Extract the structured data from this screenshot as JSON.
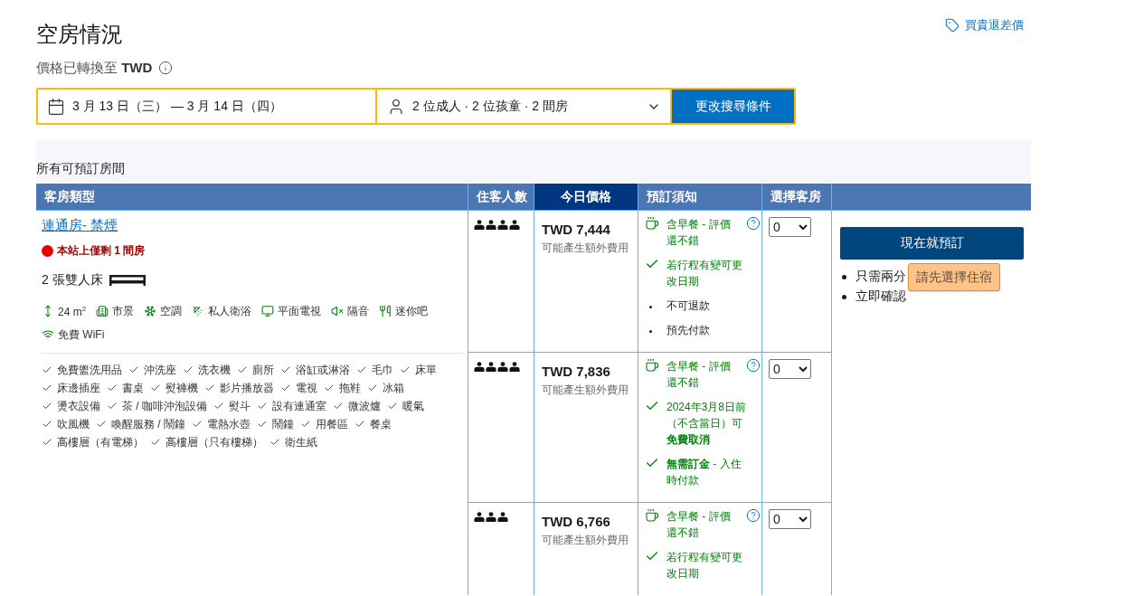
{
  "header": {
    "title": "空房情況",
    "currency_note": "價格已轉換至 **TWD**",
    "price_match_link": "買貴退差價"
  },
  "search": {
    "dates": "3 月 13 日（三） — 3 月 14 日（四）",
    "guests": "2 位成人 · 2 位孩童 · 2 間房",
    "button": "更改搜尋條件"
  },
  "rooms_section": {
    "title": "所有可預訂房間"
  },
  "table": {
    "columns": [
      {
        "label": "客房類型",
        "highlighted": false
      },
      {
        "label": "住客人數",
        "highlighted": false
      },
      {
        "label": "今日價格",
        "highlighted": true
      },
      {
        "label": "預訂須知",
        "highlighted": false
      },
      {
        "label": "選擇客房",
        "highlighted": false
      }
    ],
    "room": {
      "name": "連通房- 禁煙",
      "scarcity": "本站上僅剩 1 間房",
      "beds": "2 張雙人床",
      "facilities": [
        {
          "kind": "size",
          "label": "24 m$^{2}$"
        },
        {
          "kind": "view",
          "label": "市景"
        },
        {
          "kind": "ac",
          "label": "空調"
        },
        {
          "kind": "bathroom",
          "label": "私人衛浴"
        },
        {
          "kind": "tv",
          "label": "平面電視"
        },
        {
          "kind": "soundproof",
          "label": "隔音"
        },
        {
          "kind": "minibar",
          "label": "迷你吧"
        },
        {
          "kind": "wifi",
          "label": "免費 WiFi"
        }
      ],
      "amenities": [
        "免費盥洗用品",
        "沖洗座",
        "洗衣機",
        "廁所",
        "浴缸或淋浴",
        "毛巾",
        "床單",
        "床邊插座",
        "書桌",
        "熨褲機",
        "影片播放器",
        "電視",
        "拖鞋",
        "冰箱",
        "燙衣設備",
        "茶 / 咖啡沖泡設備",
        "熨斗",
        "設有連通室",
        "微波爐",
        "暖氣",
        "吹風機",
        "喚醒服務 / 鬧鐘",
        "電熱水壺",
        "鬧鐘",
        "用餐區",
        "餐桌",
        "高樓層（有電梯）",
        "高樓層（只有樓梯）",
        "衛生紙"
      ]
    },
    "rows": [
      {
        "occupancy": [
          {
            "kind": "person"
          },
          {
            "kind": "person"
          },
          {
            "kind": "person"
          },
          {
            "kind": "person"
          }
        ],
        "price": "TWD 7,444",
        "price_note": "可能產生額外費用",
        "conditions": [
          {
            "kind": "meal",
            "text": "含早餐 - 評價還不錯"
          },
          {
            "kind": "check",
            "text": "若行程有變可更改日期"
          },
          {
            "kind": "bullet",
            "text": "不可退款"
          },
          {
            "kind": "bullet",
            "text": "預先付款"
          }
        ],
        "quantity": "0"
      },
      {
        "occupancy": [
          {
            "kind": "person"
          },
          {
            "kind": "person"
          },
          {
            "kind": "person"
          },
          {
            "kind": "person"
          }
        ],
        "price": "TWD 7,836",
        "price_note": "可能產生額外費用",
        "conditions": [
          {
            "kind": "meal",
            "text": "含早餐 - 評價還不錯"
          },
          {
            "kind": "check",
            "text": "2024年3月8日前（不含當日）可**免費取消**"
          },
          {
            "kind": "check",
            "text": "**無需訂金** - 入住時付款"
          }
        ],
        "quantity": "0"
      },
      {
        "occupancy": [
          {
            "kind": "person"
          },
          {
            "kind": "person"
          },
          {
            "kind": "person"
          }
        ],
        "price": "TWD 6,766",
        "price_note": "可能產生額外費用",
        "conditions": [
          {
            "kind": "meal",
            "text": "含早餐 - 評價還不錯"
          },
          {
            "kind": "check",
            "text": "若行程有變可更改日期"
          }
        ],
        "quantity": "0"
      }
    ]
  },
  "booking": {
    "button": "現在就預訂",
    "benefits": [
      "只需兩分",
      "立即確認"
    ],
    "tooltip": "請先選擇住宿"
  }
}
